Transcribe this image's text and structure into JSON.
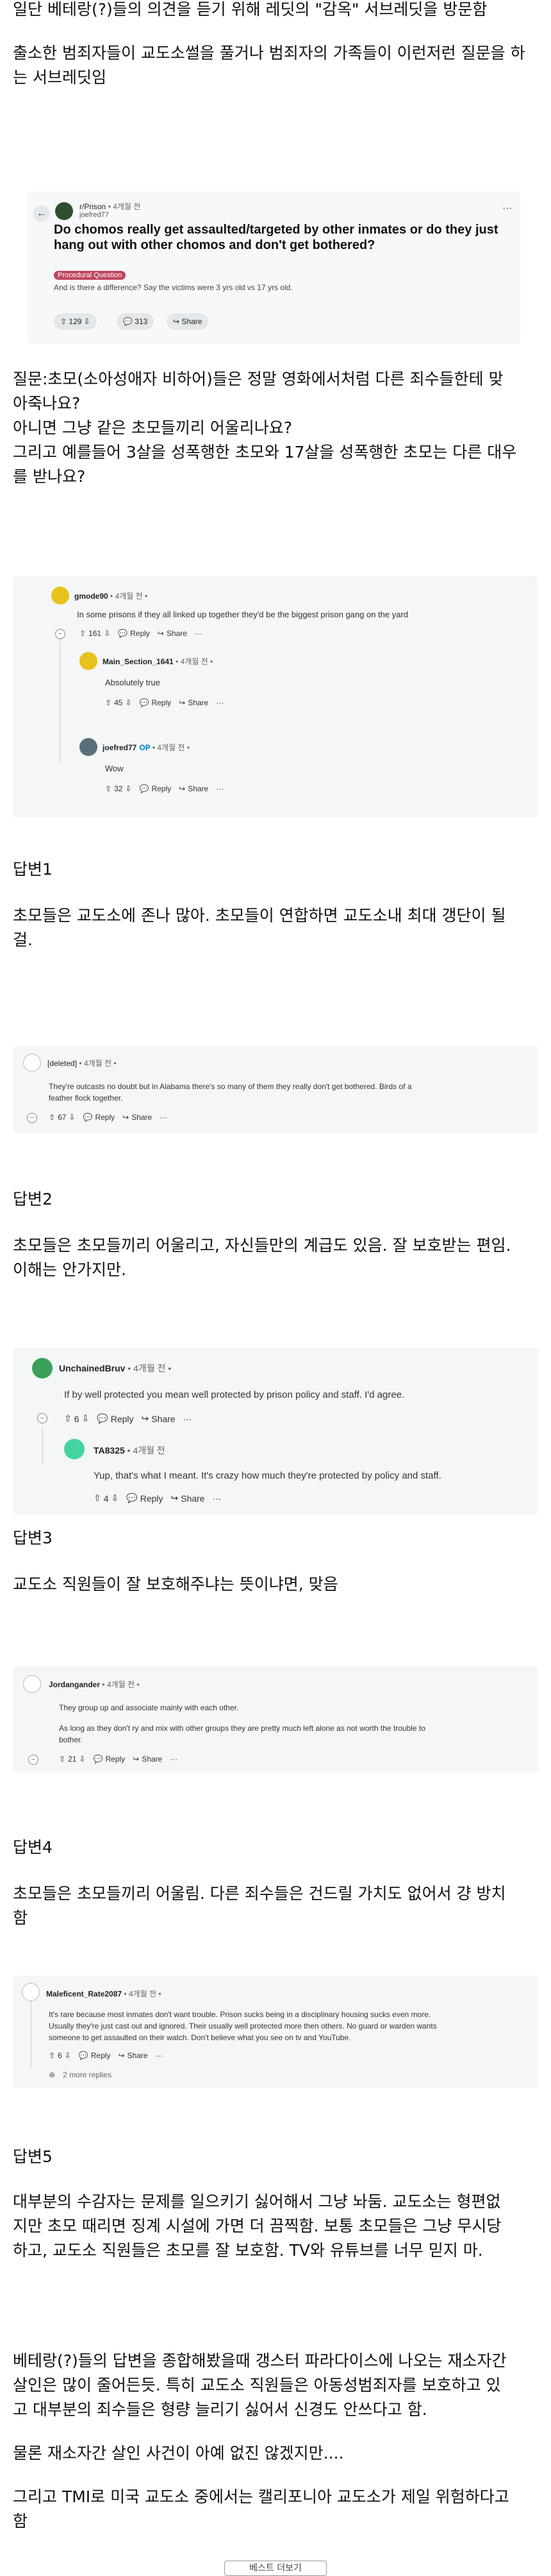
{
  "intro": {
    "line1": "일단 베테랑(?)들의 의견을 듣기 위해 레딧의 \"감옥\" 서브레딧을 방문함",
    "line2": "출소한 범죄자들이 교도소썰을 풀거나 범죄자의 가족들이 이런저런 질문을 하는 서브레딧임"
  },
  "post": {
    "subreddit": "r/Prison",
    "time": "• 4개월 전",
    "user": "joefred77",
    "title": "Do chomos really get assaulted/targeted by other inmates or do they just hang out with other chomos and don't get bothered?",
    "flair": "Procedural Question",
    "body": "And is there a difference? Say the victims were 3 yrs old vs 17 yrs old.",
    "votes": "129",
    "comments": "313",
    "share": "Share"
  },
  "question": {
    "line1": "질문:초모(소아성애자 비하어)들은 정말 영화에서처럼 다른 죄수들한테 맞",
    "line2": "아죽나요?",
    "line3": "아니면 그냥 같은 초모들끼리 어울리나요?",
    "line4": "그리고 예를들어 3살을 성폭행한 초모와 17살을 성폭행한 초모는 다른 대우",
    "line5": "를 받나요?"
  },
  "thread1": {
    "c1": {
      "user": "gmode90",
      "time": "• 4개월 전 •",
      "text": "In some prisons if they all linked up together they'd be the biggest prison gang on the yard",
      "votes": "161"
    },
    "c2": {
      "user": "Main_Section_1641",
      "time": "• 4개월 전 •",
      "text": "Absolutely true",
      "votes": "45"
    },
    "c3": {
      "user": "joefred77",
      "op": "OP",
      "time": "• 4개월 전 •",
      "text": "Wow",
      "votes": "32"
    },
    "reply": "Reply",
    "share": "Share",
    "more": "···"
  },
  "answer1": {
    "heading": "답변1",
    "line1": "초모들은 교도소에 존나 많아. 초모들이 연합하면 교도소내 최대 갱단이 될",
    "line2": "걸."
  },
  "thread2": {
    "c1": {
      "user": "[deleted]",
      "time": "• 4개월 전 •",
      "line1": "They're outcasts no doubt but in Alabama there's so many of them they really don't get bothered. Birds of a",
      "line2": "feather flock together.",
      "votes": "67"
    },
    "reply": "Reply",
    "share": "Share",
    "more": "···"
  },
  "answer2": {
    "heading": "답변2",
    "line1": "초모들은 초모들끼리 어울리고, 자신들만의 계급도 있음. 잘 보호받는 편임.",
    "line2": "이해는 안가지만."
  },
  "thread3": {
    "c1": {
      "user": "UnchainedBruv",
      "time": "• 4개월 전 •",
      "text": "If by well protected you mean well protected by prison policy and staff. I'd agree.",
      "votes": "6"
    },
    "c2": {
      "user": "TA8325",
      "time": "• 4개월 전",
      "text": "Yup, that's what I meant. It's crazy how much they're protected by policy and staff.",
      "votes": "4"
    },
    "reply": "Reply",
    "share": "Share",
    "more": "···"
  },
  "answer3": {
    "heading": "답변3",
    "line1": "교도소 직원들이 잘 보호해주냐는 뜻이냐면, 맞음"
  },
  "thread4": {
    "c1": {
      "user": "Jordangander",
      "time": "• 4개월 전 •",
      "line1": "They group up and associate mainly with each other.",
      "line2": "As long as they don't ry and mix with other groups they are pretty much left alone as not worth the trouble to",
      "line3": "bother.",
      "votes": "21"
    },
    "reply": "Reply",
    "share": "Share",
    "more": "···"
  },
  "answer4": {
    "heading": "답변4",
    "line1": "초모들은 초모들끼리 어울림. 다른 죄수들은 건드릴 가치도 없어서 걍 방치",
    "line2": "함"
  },
  "thread5": {
    "c1": {
      "user": "Maleficent_Rate2087",
      "time": "• 4개월 전 •",
      "line1": "It's rare because most inmates don't want trouble. Prison sucks being in a disciplinary housing sucks even more.",
      "line2": "Usually they're just cast out and ignored. Their usually well protected more then others. No guard or warden wants",
      "line3": "someone to get assaulted on their watch. Don't believe what you see on tv and YouTube.",
      "votes": "6"
    },
    "reply": "Reply",
    "share": "Share",
    "more": "···",
    "more_replies": "2 more replies"
  },
  "answer5": {
    "heading": "답변5",
    "line1": "대부분의 수감자는 문제를 일으키기 싫어해서 그냥 놔둠. 교도소는 형편없",
    "line2": "지만 초모 때리면 징계 시설에 가면 더 끔찍함. 보통 초모들은 그냥 무시당",
    "line3": "하고, 교도소 직원들은 초모를 잘 보호함. TV와 유튜브를 너무 믿지 마."
  },
  "summary": {
    "line1": "베테랑(?)들의 답변을 종합해봤을때 갱스터 파라다이스에 나오는 재소자간",
    "line2": "살인은 많이 줄어든듯. 특히 교도소 직원들은 아동성범죄자를 보호하고 있",
    "line3": "고 대부분의 죄수들은 형량 늘리기 싫어서 신경도 안쓰다고 함.",
    "line4": "물론 재소자간 살인 사건이 아예 없진 않겠지만....",
    "line5": "그리고 TMI로 미국 교도소 중에서는 캘리포니아 교도소가 제일 위험하다고",
    "line6": "함"
  },
  "footer": {
    "button": "베스트 더보기"
  },
  "colors": {
    "op_blue": "#0079d3",
    "flair_pink": "#c0455f",
    "card_bg": "#f5f6f7"
  }
}
